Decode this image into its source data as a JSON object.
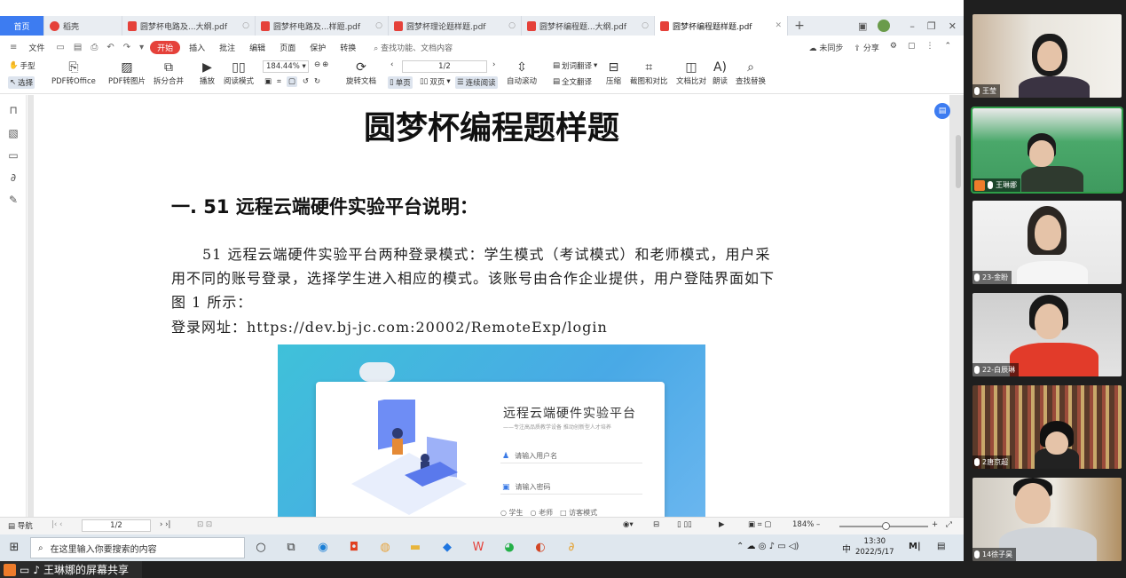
{
  "tabs": [
    {
      "label": "首页",
      "kind": "home"
    },
    {
      "label": "稻壳",
      "kind": "daoke"
    },
    {
      "label": "圆梦杯电路及...大纲.pdf",
      "kind": "pdf"
    },
    {
      "label": "圆梦杯电路及...样题.pdf",
      "kind": "pdf"
    },
    {
      "label": "圆梦杯理论题样题.pdf",
      "kind": "pdf"
    },
    {
      "label": "圆梦杯编程题...大纲.pdf",
      "kind": "pdf"
    },
    {
      "label": "圆梦杯编程题样题.pdf",
      "kind": "pdf-active"
    }
  ],
  "menubar": {
    "file": "文件",
    "items": [
      "开始",
      "插入",
      "批注",
      "编辑",
      "页面",
      "保护",
      "转换"
    ],
    "search": "查找功能、文档内容",
    "right": [
      "未同步",
      "分享"
    ]
  },
  "toolbar": {
    "hand": "手型",
    "select": "选择",
    "pdf_to_office": "PDF转Office",
    "pdf_to_image": "PDF转图片",
    "split_merge": "拆分合并",
    "play": "播放",
    "read_mode": "阅读模式",
    "zoom": "184.44%",
    "rotate": "旋转文档",
    "single": "单页",
    "double": "双页",
    "continuous": "连续阅读",
    "page": "1/2",
    "auto_scroll": "自动滚动",
    "translate_word": "划词翻译",
    "translate_all": "全文翻译",
    "compress": "压缩",
    "screenshot": "截图和对比",
    "compare": "文档比对",
    "read_aloud": "朗读",
    "find_replace": "查找替换"
  },
  "document": {
    "title": "圆梦杯编程题样题",
    "heading": "一. 51 远程云端硬件实验平台说明：",
    "para_line1": "51 远程云端硬件实验平台两种登录模式：学生模式（考试模式）和老师模式，用户采",
    "para_line2": "用不同的账号登录，选择学生进入相应的模式。该账号由合作企业提供，用户登陆界面如下",
    "para_line3": "图 1 所示：",
    "url_line": "登录网址：https://dev.bj-jc.com:20002/RemoteExp/login",
    "login": {
      "title": "远程云端硬件实验平台",
      "subtitle": "——专注高品质教学设备 推动创新型人才培养",
      "username_placeholder": "请输入用户名",
      "password_placeholder": "请输入密码",
      "role_student": "学生",
      "role_teacher": "老师",
      "visitor_mode": "访客模式"
    }
  },
  "statusbar": {
    "nav": "导航",
    "page": "1/2",
    "zoom": "184%"
  },
  "taskbar": {
    "search_placeholder": "在这里输入你要搜索的内容",
    "ime": "中",
    "time": "13:30",
    "date": "2022/5/17"
  },
  "share": {
    "label": "王琳娜的屏幕共享"
  },
  "participants": [
    {
      "name": "王莹"
    },
    {
      "name": "王琳娜"
    },
    {
      "name": "23-金盼"
    },
    {
      "name": "22-白辰琳"
    },
    {
      "name": "2唐京超"
    },
    {
      "name": "14徐子昊"
    }
  ],
  "colors": {
    "accent": "#3d7cf1",
    "wps_red": "#e5413a",
    "speaker_green": "#2e9d48",
    "host_orange": "#ee7c2b"
  }
}
